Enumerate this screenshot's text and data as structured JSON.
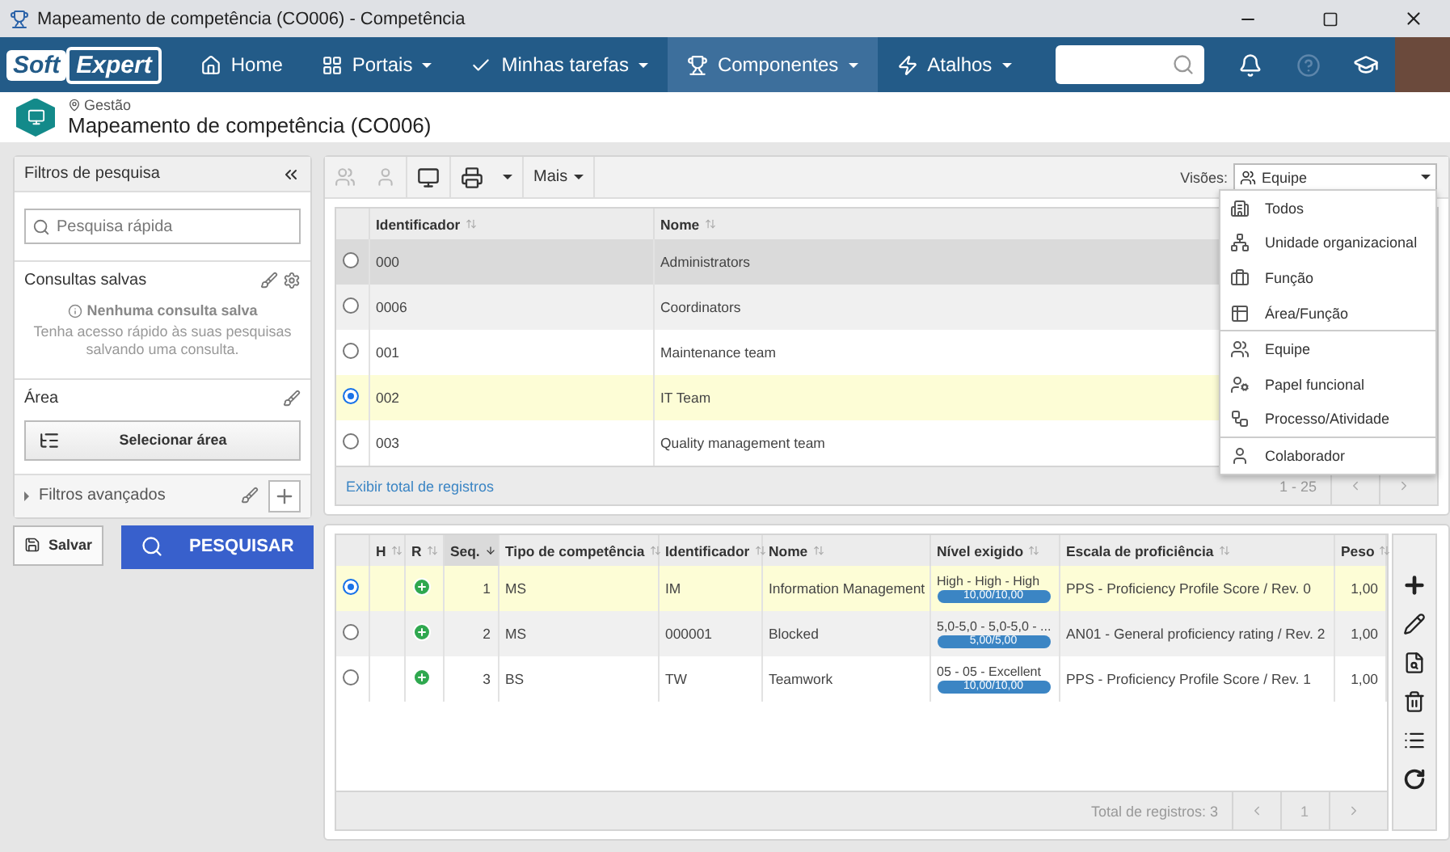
{
  "window": {
    "title": "Mapeamento de competência (CO006) - Competência"
  },
  "nav": {
    "logo_left": "Soft",
    "logo_right": "Expert",
    "items": [
      {
        "label": "Home",
        "has_menu": false,
        "selected": false
      },
      {
        "label": "Portais",
        "has_menu": true,
        "selected": false
      },
      {
        "label": "Minhas tarefas",
        "has_menu": true,
        "selected": false
      },
      {
        "label": "Componentes",
        "has_menu": true,
        "selected": true
      },
      {
        "label": "Atalhos",
        "has_menu": true,
        "selected": false
      }
    ]
  },
  "header": {
    "breadcrumb": "Gestão",
    "title": "Mapeamento de competência (CO006)"
  },
  "filters": {
    "title": "Filtros de pesquisa",
    "search_placeholder": "Pesquisa rápida",
    "saved_title": "Consultas salvas",
    "saved_empty_title": "Nenhuma consulta salva",
    "saved_empty_text": "Tenha acesso rápido às suas pesquisas salvando uma consulta.",
    "area_title": "Área",
    "area_button": "Selecionar área",
    "advanced": "Filtros avançados",
    "save_button": "Salvar",
    "search_button": "PESQUISAR"
  },
  "toolbar": {
    "more": "Mais",
    "views_label": "Visões:",
    "views_value": "Equipe"
  },
  "views_menu": {
    "groups": [
      [
        {
          "label": "Todos",
          "kind": "building"
        },
        {
          "label": "Unidade organizacional",
          "kind": "org"
        },
        {
          "label": "Função",
          "kind": "briefcase"
        },
        {
          "label": "Área/Função",
          "kind": "grid"
        }
      ],
      [
        {
          "label": "Equipe",
          "kind": "team"
        },
        {
          "label": "Papel funcional",
          "kind": "role"
        },
        {
          "label": "Processo/Atividade",
          "kind": "process"
        }
      ],
      [
        {
          "label": "Colaborador",
          "kind": "person"
        }
      ]
    ]
  },
  "teams": {
    "columns": [
      "Identificador",
      "Nome"
    ],
    "rows": [
      {
        "id": "000",
        "name": "Administrators",
        "selected": false,
        "hovered": true
      },
      {
        "id": "0006",
        "name": "Coordinators",
        "selected": false,
        "hovered": false
      },
      {
        "id": "001",
        "name": "Maintenance team",
        "selected": false,
        "hovered": false
      },
      {
        "id": "002",
        "name": "IT Team",
        "selected": true,
        "hovered": false
      },
      {
        "id": "003",
        "name": "Quality management team",
        "selected": false,
        "hovered": false
      }
    ],
    "footer_link": "Exibir total de registros",
    "range": "1 - 25"
  },
  "competences": {
    "columns": [
      {
        "label": "H",
        "sorted": false
      },
      {
        "label": "R",
        "sorted": false
      },
      {
        "label": "Seq.",
        "sorted": true
      },
      {
        "label": "Tipo de competência",
        "sorted": false
      },
      {
        "label": "Identificador",
        "sorted": false
      },
      {
        "label": "Nome",
        "sorted": false
      },
      {
        "label": "Nível exigido",
        "sorted": false
      },
      {
        "label": "Escala de proficiência",
        "sorted": false
      },
      {
        "label": "Peso",
        "sorted": false
      }
    ],
    "rows": [
      {
        "selected": true,
        "seq": "1",
        "type": "MS",
        "id": "IM",
        "name": "Information Management",
        "level_text": "High - High - High",
        "level_reading": "10,00/10,00",
        "level": 1,
        "scale": "PPS - Proficiency Profile Score / Rev. 0",
        "weight": "1,00"
      },
      {
        "selected": false,
        "seq": "2",
        "type": "MS",
        "id": "000001",
        "name": "Blocked",
        "level_text": "5,0-5,0 - 5,0-5,0 - ...",
        "level_reading": "5,00/5,00",
        "level": 1,
        "scale": "AN01 - General proficiency rating / Rev. 2",
        "weight": "1,00"
      },
      {
        "selected": false,
        "seq": "3",
        "type": "BS",
        "id": "TW",
        "name": "Teamwork",
        "level_text": "05 - 05 - Excellent",
        "level_reading": "10,00/10,00",
        "level": 1,
        "scale": "PPS - Proficiency Profile Score / Rev. 1",
        "weight": "1,00"
      }
    ],
    "total": "Total de registros: 3",
    "page": "1"
  }
}
